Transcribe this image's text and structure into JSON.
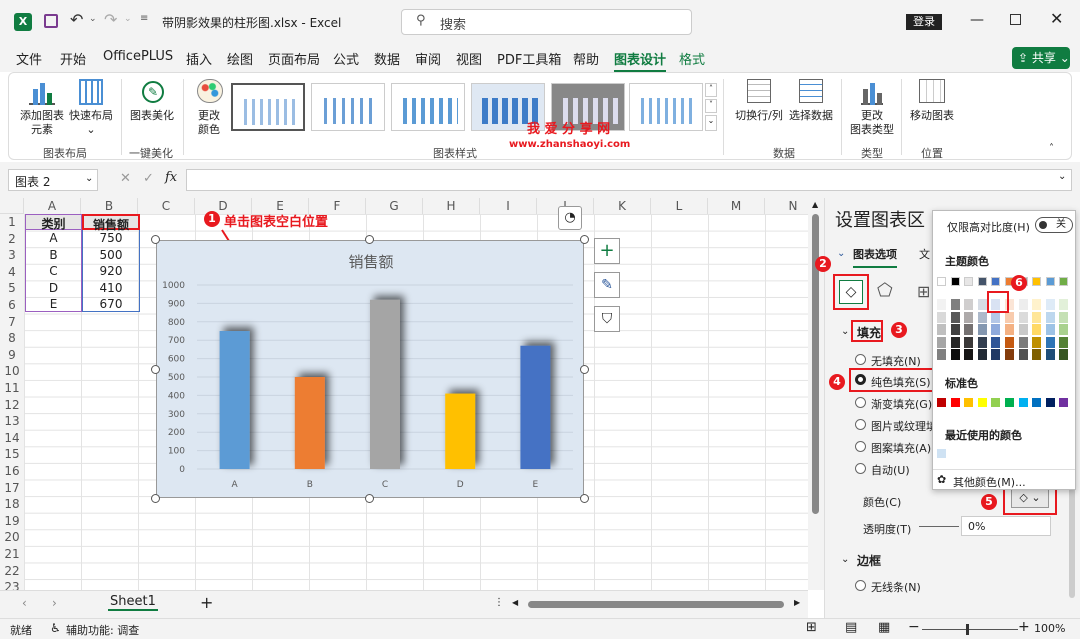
{
  "app": {
    "filename": "带阴影效果的柱形图.xlsx",
    "appname": "Excel",
    "search_placeholder": "搜索",
    "login": "登录",
    "share": "共享"
  },
  "tabs": [
    "文件",
    "开始",
    "OfficePLUS",
    "插入",
    "绘图",
    "页面布局",
    "公式",
    "数据",
    "审阅",
    "视图",
    "PDF工具箱",
    "帮助",
    "图表设计",
    "格式"
  ],
  "ribbon": {
    "add_element": "添加图表",
    "add_element2": "元素",
    "quick_layout": "快速布局",
    "beautify": "图表美化",
    "change_color": "更改",
    "change_color2": "颜色",
    "switch_rowcol": "切换行/列",
    "select_data": "选择数据",
    "change_type": "更改",
    "change_type2": "图表类型",
    "move_chart": "移动图表",
    "group_layout": "图表布局",
    "group_beautify": "一键美化",
    "group_styles": "图表样式",
    "group_data": "数据",
    "group_type": "类型",
    "group_position": "位置",
    "watermark": "我 爱 分 享 网",
    "watermark_url": "www.zhanshaoyi.com"
  },
  "formula": {
    "namebox": "图表 2",
    "fx": "fx"
  },
  "grid": {
    "cols": [
      "A",
      "B",
      "C",
      "D",
      "E",
      "F",
      "G",
      "H",
      "I",
      "J",
      "K",
      "L",
      "M",
      "N"
    ],
    "rows": [
      "1",
      "2",
      "3",
      "4",
      "5",
      "6",
      "7",
      "8",
      "9",
      "10",
      "11",
      "12",
      "13",
      "14",
      "15",
      "16",
      "17",
      "18",
      "19",
      "20",
      "21",
      "22",
      "23"
    ],
    "header": [
      "类别",
      "销售额"
    ],
    "data": [
      [
        "A",
        "750"
      ],
      [
        "B",
        "500"
      ],
      [
        "C",
        "920"
      ],
      [
        "D",
        "410"
      ],
      [
        "E",
        "670"
      ]
    ]
  },
  "annotation1": "单击图表空白位置",
  "chart_data": {
    "type": "bar",
    "title": "销售额",
    "categories": [
      "A",
      "B",
      "C",
      "D",
      "E"
    ],
    "values": [
      750,
      500,
      920,
      410,
      670
    ],
    "ylim": [
      0,
      1000
    ],
    "yticks": [
      0,
      100,
      200,
      300,
      400,
      500,
      600,
      700,
      800,
      900,
      1000
    ],
    "colors": [
      "#5b9bd5",
      "#ed7d31",
      "#a5a5a5",
      "#ffc000",
      "#4472c4"
    ],
    "grid": true
  },
  "pane": {
    "title": "设置图表区",
    "tab_options": "图表选项",
    "tab_text": "文",
    "fill_header": "填充",
    "opt_none": "无填充(N)",
    "opt_solid": "纯色填充(S)",
    "opt_gradient": "渐变填充(G)",
    "opt_picture": "图片或纹理填",
    "opt_pattern": "图案填充(A)",
    "opt_auto": "自动(U)",
    "color_label": "颜色(C)",
    "transparency_label": "透明度(T)",
    "transparency_value": "0%",
    "border_header": "边框",
    "opt_noline": "无线条(N)"
  },
  "popup": {
    "high_contrast": "仅限高对比度(H)",
    "toggle": "关",
    "theme_colors": "主题颜色",
    "standard_colors": "标准色",
    "recent_colors": "最近使用的颜色",
    "more_colors": "其他颜色(M)..."
  },
  "steps": [
    "1",
    "2",
    "3",
    "4",
    "5",
    "6"
  ],
  "sheetbar": {
    "sheet1": "Sheet1",
    "add": "+"
  },
  "status": {
    "ready": "就绪",
    "accessibility": "辅助功能: 调查",
    "zoom": "100%"
  }
}
